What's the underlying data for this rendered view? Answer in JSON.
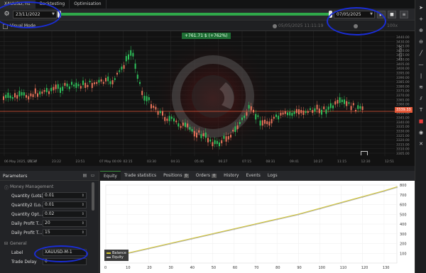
{
  "tabs": [
    {
      "label": "XAUUSD, h1"
    },
    {
      "label": "Backtesting"
    },
    {
      "label": "Optimisation"
    }
  ],
  "toolbar": {
    "start_date": "23/11/2022",
    "end_date": "07/05/2025",
    "play_icon": "▶",
    "stop_icon": "■",
    "menu_icon": "≡"
  },
  "visual_mode": {
    "label": "Visual Mode",
    "date_readout": "05/05/2025 11:11:19",
    "speed_label": "100x"
  },
  "chart": {
    "profit_label": "+761.71 $ (+762%)",
    "price_label": "3339.33",
    "symbol_vertical": "XAUUSD",
    "y_ticks": [
      "3440.00",
      "3430.00",
      "3425.00",
      "3420.00",
      "3415.00",
      "3410.00",
      "3405.00",
      "3400.00",
      "3395.00",
      "3390.00",
      "3385.00",
      "3380.00",
      "3375.00",
      "3370.00",
      "3365.00",
      "3360.00",
      "3355.00",
      "3350.00",
      "3345.00",
      "3340.00",
      "3335.00",
      "3330.00",
      "3325.00",
      "3320.00",
      "3315.00",
      "3310.00",
      "3305.00"
    ],
    "x_ticks": [
      "06 May 2025, UTC-4",
      "21:37",
      "23:22",
      "23:51",
      "07 May 00:09",
      "02:15",
      "03:30",
      "04:31",
      "05:46",
      "06:27",
      "07:15",
      "08:31",
      "09:41",
      "10:27",
      "11:15",
      "12:30",
      "12:51"
    ],
    "colors": {
      "bull": "#2ec05a",
      "bear": "#e8735a",
      "price_line": "#e85a3a"
    }
  },
  "params": {
    "title": "Parameters",
    "section_money": "Money Management",
    "section_general": "General",
    "rows": [
      {
        "label": "Quantity (Lots)",
        "value": "0.01"
      },
      {
        "label": "Quantity2 (Lo...",
        "value": "0.01"
      },
      {
        "label": "Quantity Opt...",
        "value": "0.02"
      },
      {
        "label": "Daily Profit T...",
        "value": "20"
      },
      {
        "label": "Daily Profit T...",
        "value": "15"
      }
    ],
    "general_rows": [
      {
        "label": "Label",
        "value": "XAUUSD-M-1"
      },
      {
        "label": "Trade Delay",
        "value": "0"
      }
    ]
  },
  "bottom_tabs": [
    {
      "label": "Equity",
      "count": ""
    },
    {
      "label": "Trade statistics",
      "count": ""
    },
    {
      "label": "Positions",
      "count": "0"
    },
    {
      "label": "Orders",
      "count": "0"
    },
    {
      "label": "History",
      "count": ""
    },
    {
      "label": "Events",
      "count": ""
    },
    {
      "label": "Logs",
      "count": ""
    }
  ],
  "equity": {
    "legend": [
      "Balance",
      "Equity"
    ],
    "colors": {
      "balance": "#d4c72e",
      "equity": "#b7b7b7"
    },
    "x_ticks": [
      "0",
      "10",
      "20",
      "30",
      "40",
      "50",
      "60",
      "70",
      "80",
      "90",
      "100",
      "110",
      "120",
      "130"
    ],
    "y_ticks": [
      "800",
      "700",
      "600",
      "500",
      "400",
      "300",
      "200",
      "100"
    ],
    "chart_data": {
      "type": "line",
      "x": [
        0,
        10,
        20,
        30,
        40,
        50,
        60,
        70,
        80,
        90,
        100,
        110,
        120,
        130,
        136
      ],
      "series": [
        {
          "name": "Balance",
          "values": [
            60,
            100,
            150,
            200,
            250,
            300,
            350,
            400,
            450,
            500,
            560,
            620,
            680,
            740,
            780
          ]
        },
        {
          "name": "Equity",
          "values": [
            55,
            95,
            145,
            195,
            245,
            295,
            345,
            395,
            445,
            495,
            555,
            615,
            675,
            735,
            775
          ]
        }
      ],
      "ylim": [
        0,
        800
      ],
      "xlim": [
        0,
        136
      ]
    }
  }
}
